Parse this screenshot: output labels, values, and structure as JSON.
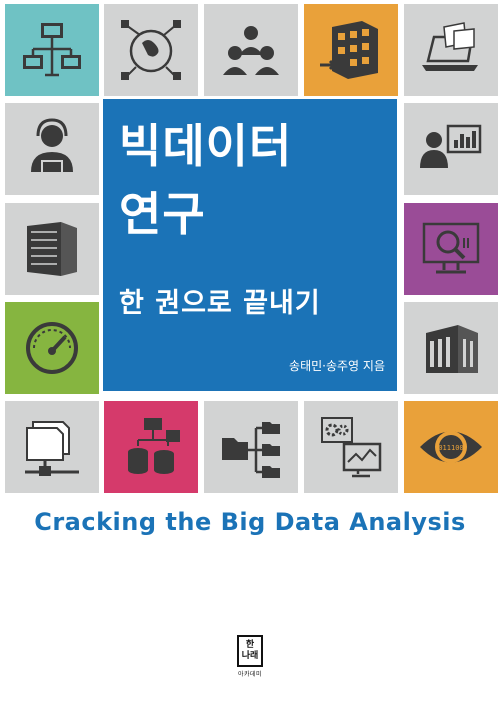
{
  "cover": {
    "title_line1": "빅데이터",
    "title_line2": "연구",
    "title_line3": "한 권으로 끝내기",
    "authors": "송태민·송주영 지음",
    "english_title": "Cracking the Big Data Analysis"
  },
  "publisher": {
    "logo_line1": "한",
    "logo_line2": "나래",
    "name_small": "아카데미"
  },
  "colors": {
    "panel_blue": "#1b73b7",
    "tile_grey": "#d2d3d3",
    "teal": "#6fc2c4",
    "orange": "#e9a13a",
    "purple": "#9a4c97",
    "green": "#86b540",
    "pink": "#d53a6b",
    "icon_dark": "#3a3a3a"
  },
  "tiles": [
    {
      "icon": "network-computers-icon"
    },
    {
      "icon": "globe-network-icon"
    },
    {
      "icon": "people-group-icon"
    },
    {
      "icon": "building-cubes-icon"
    },
    {
      "icon": "laptop-documents-icon"
    },
    {
      "icon": "headset-operator-icon"
    },
    {
      "icon": "analyst-chart-icon"
    },
    {
      "icon": "server-rack-icon"
    },
    {
      "icon": "magnify-data-icon"
    },
    {
      "icon": "speedometer-icon"
    },
    {
      "icon": "datacenter-building-icon"
    },
    {
      "icon": "folders-network-icon"
    },
    {
      "icon": "database-hierarchy-icon"
    },
    {
      "icon": "folder-tree-icon"
    },
    {
      "icon": "gears-dashboard-icon"
    },
    {
      "icon": "eye-binary-icon"
    }
  ]
}
